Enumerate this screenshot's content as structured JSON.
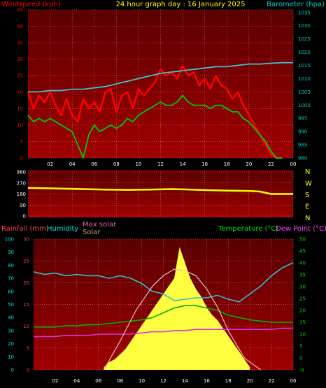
{
  "header": {
    "left_title": "Windspeed (kph)",
    "center_title": "24 hour graph day : 16 January 2025",
    "right_title": "Barometer (hpa)"
  },
  "colors": {
    "background": "#000000",
    "plot_top": "#5a0000",
    "plot_bottom": "#a00000",
    "grid": "#ff8080",
    "wind_series": "#ff0000",
    "windavg_series": "#00cc00",
    "barometer_series": "#40c0d0",
    "direction_series": "#ffff00",
    "humidity_series": "#30c0d0",
    "temperature_series": "#00b000",
    "dewpoint_series": "#e030e0",
    "solar_series": "#ffff40",
    "maxsolar_series": "#e0c0c0",
    "rainfall_axis": "#ff4040",
    "humidity_axis": "#00e0e0",
    "temperature_axis": "#00e000",
    "title_text": "#ffff00",
    "right_axis_text": "#00d0c0"
  },
  "chart_data": [
    {
      "type": "line",
      "x_ticks": [
        "02",
        "04",
        "06",
        "08",
        "10",
        "12",
        "14",
        "16",
        "18",
        "20",
        "22",
        "00"
      ],
      "y_left_ticks": [
        "0",
        "5",
        "10",
        "15",
        "20",
        "25",
        "30",
        "35",
        "40",
        "45"
      ],
      "y_left_range": [
        0,
        45
      ],
      "y_right_ticks": [
        "980",
        "985",
        "990",
        "995",
        "1000",
        "1005",
        "1010",
        "1015",
        "1020",
        "1025",
        "1030",
        "1035"
      ],
      "y_right_range": [
        980,
        1036
      ],
      "grid": true,
      "series": [
        {
          "name": "Windspeed (kph)",
          "axis": "left",
          "x": [
            0,
            0.5,
            1,
            1.5,
            2,
            2.5,
            3,
            3.5,
            4,
            4.5,
            5,
            5.5,
            6,
            6.5,
            7,
            7.5,
            8,
            8.5,
            9,
            9.5,
            10,
            10.5,
            11,
            11.5,
            12,
            12.5,
            13,
            13.5,
            14,
            14.5,
            15,
            15.5,
            16,
            16.5,
            17,
            17.5,
            18,
            18.5,
            19,
            19.5,
            20,
            20.5,
            21,
            21.5,
            22,
            22.5,
            23
          ],
          "values": [
            20,
            15,
            19,
            17,
            20,
            16,
            13,
            18,
            13,
            11,
            18,
            15,
            17,
            14,
            20,
            21,
            14,
            19,
            20,
            15,
            21,
            19,
            21,
            23,
            27,
            25,
            26,
            24,
            28,
            25,
            26,
            22,
            24,
            21,
            25,
            22,
            21,
            18,
            20,
            16,
            13,
            10,
            7,
            4,
            1,
            0,
            0
          ]
        },
        {
          "name": "Wind average",
          "axis": "left",
          "x": [
            0,
            0.5,
            1,
            1.5,
            2,
            2.5,
            3,
            3.5,
            4,
            4.5,
            5,
            5.5,
            6,
            6.5,
            7,
            7.5,
            8,
            8.5,
            9,
            9.5,
            10,
            10.5,
            11,
            11.5,
            12,
            12.5,
            13,
            13.5,
            14,
            14.5,
            15,
            15.5,
            16,
            16.5,
            17,
            17.5,
            18,
            18.5,
            19,
            19.5,
            20,
            20.5,
            21,
            21.5,
            22,
            22.5,
            23
          ],
          "values": [
            13,
            11,
            12,
            11,
            12,
            11,
            10,
            9,
            8,
            4,
            0,
            7,
            10,
            8,
            9,
            10,
            9,
            10,
            12,
            11,
            13,
            14,
            15,
            16,
            17,
            16,
            16,
            17,
            19,
            17,
            16,
            16,
            16,
            15,
            16,
            16,
            15,
            14,
            14,
            12,
            11,
            9,
            7,
            5,
            2,
            0,
            0
          ]
        },
        {
          "name": "Barometer (hpa)",
          "axis": "right",
          "x": [
            0,
            1,
            2,
            3,
            4,
            5,
            6,
            7,
            8,
            9,
            10,
            11,
            12,
            13,
            14,
            15,
            16,
            17,
            18,
            19,
            20,
            21,
            22,
            23,
            24
          ],
          "values": [
            1005,
            1005,
            1005.5,
            1005.5,
            1006,
            1006,
            1006.5,
            1007,
            1008,
            1009,
            1010,
            1011,
            1012,
            1012.5,
            1013,
            1013.5,
            1014,
            1014.5,
            1014.5,
            1015,
            1015.5,
            1015.5,
            1015.8,
            1016,
            1016
          ]
        }
      ]
    },
    {
      "type": "line",
      "x_ticks": [
        "02",
        "04",
        "06",
        "08",
        "10",
        "12",
        "14",
        "16",
        "18",
        "20",
        "22",
        "00"
      ],
      "y_left_ticks": [
        "0",
        "90",
        "180",
        "270",
        "360"
      ],
      "y_left_range": [
        0,
        360
      ],
      "y_right_labels": [
        "N",
        "W",
        "S",
        "E",
        "N"
      ],
      "grid": true,
      "series": [
        {
          "name": "Wind direction",
          "x": [
            0,
            1,
            2,
            3,
            4,
            5,
            6,
            7,
            8,
            9,
            10,
            11,
            12,
            13,
            14,
            15,
            16,
            17,
            18,
            19,
            20,
            21,
            22,
            23,
            24
          ],
          "values": [
            230,
            228,
            226,
            224,
            222,
            220,
            218,
            216,
            215,
            214,
            215,
            216,
            218,
            220,
            218,
            215,
            212,
            210,
            208,
            206,
            205,
            200,
            180,
            180,
            180
          ]
        }
      ]
    },
    {
      "type": "line",
      "x_ticks": [
        "02",
        "04",
        "06",
        "08",
        "10",
        "12",
        "14",
        "16",
        "18",
        "20",
        "22",
        "00"
      ],
      "legend_left": {
        "rainfall": "Rainfall (mm)",
        "humidity": "Humidity",
        "max_solar": "Max solar",
        "solar": "Solar"
      },
      "legend_right": {
        "temperature": "Temperature (°C)",
        "dew_point": "Dew Point (°C)"
      },
      "rainfall_ticks": [
        "0",
        "5",
        "10",
        "15",
        "20",
        "25",
        "30"
      ],
      "rainfall_range": [
        0,
        30
      ],
      "humidity_ticks": [
        "0",
        "10",
        "20",
        "30",
        "40",
        "50",
        "60",
        "70",
        "80",
        "90",
        "100"
      ],
      "humidity_range": [
        0,
        100
      ],
      "temperature_ticks": [
        "-5",
        "0",
        "5",
        "10",
        "15",
        "20",
        "25",
        "30",
        "35",
        "40",
        "45",
        "50"
      ],
      "temperature_range": [
        -5,
        50
      ],
      "solar_range": [
        0,
        1000
      ],
      "grid": true,
      "series": [
        {
          "name": "Humidity",
          "axis": "humidity",
          "x": [
            0,
            1,
            2,
            3,
            4,
            5,
            6,
            7,
            8,
            9,
            10,
            11,
            12,
            13,
            14,
            15,
            16,
            17,
            18,
            19,
            20,
            21,
            22,
            23,
            24
          ],
          "values": [
            75,
            73,
            74,
            72,
            73,
            72,
            72,
            70,
            72,
            70,
            66,
            60,
            58,
            53,
            54,
            55,
            55,
            57,
            54,
            52,
            58,
            64,
            72,
            78,
            82
          ]
        },
        {
          "name": "Temperature (°C)",
          "axis": "temperature",
          "x": [
            0,
            1,
            2,
            3,
            4,
            5,
            6,
            7,
            8,
            9,
            10,
            11,
            12,
            13,
            14,
            15,
            16,
            17,
            18,
            19,
            20,
            21,
            22,
            23,
            24
          ],
          "values": [
            13,
            13,
            13,
            13.5,
            13.5,
            14,
            14,
            14.5,
            15,
            15.5,
            16,
            17,
            19,
            21,
            22,
            22,
            21,
            20,
            18,
            17,
            16,
            15.5,
            15,
            15,
            15
          ]
        },
        {
          "name": "Dew Point (°C)",
          "axis": "temperature",
          "x": [
            0,
            1,
            2,
            3,
            4,
            5,
            6,
            7,
            8,
            9,
            10,
            11,
            12,
            13,
            14,
            15,
            16,
            17,
            18,
            19,
            20,
            21,
            22,
            23,
            24
          ],
          "values": [
            9,
            9,
            9,
            9.5,
            9.5,
            9.5,
            10,
            10,
            10,
            10,
            10.5,
            11,
            11,
            11.5,
            11.5,
            12,
            12,
            12,
            12,
            12,
            12,
            12,
            12,
            12.5,
            12.5
          ]
        },
        {
          "name": "Solar",
          "axis": "solar",
          "x": [
            6.5,
            7,
            7.5,
            8,
            8.5,
            9,
            9.5,
            10,
            10.5,
            11,
            11.5,
            12,
            12.5,
            13,
            13.5,
            14,
            14.5,
            15,
            15.5,
            16,
            16.5,
            17,
            17.5,
            18,
            18.5,
            19,
            19.5,
            20
          ],
          "values": [
            20,
            60,
            80,
            120,
            160,
            220,
            280,
            340,
            400,
            460,
            520,
            580,
            640,
            700,
            940,
            820,
            700,
            620,
            560,
            480,
            420,
            380,
            320,
            260,
            200,
            140,
            80,
            20
          ]
        },
        {
          "name": "Max solar",
          "axis": "solar",
          "x": [
            6.5,
            8,
            9.5,
            11,
            12,
            13,
            14,
            15,
            16,
            17,
            18,
            19.5,
            21
          ],
          "values": [
            0,
            220,
            460,
            640,
            720,
            770,
            760,
            720,
            620,
            480,
            300,
            90,
            0
          ]
        }
      ]
    }
  ]
}
